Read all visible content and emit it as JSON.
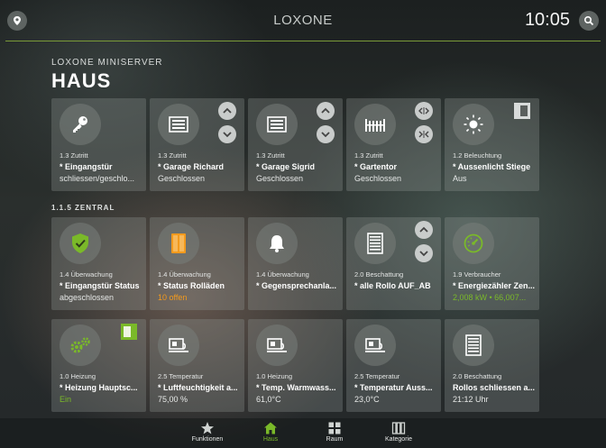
{
  "header": {
    "app_title": "LOXONE",
    "clock": "10:05",
    "accent_color": "#7ab929"
  },
  "server_label": "LOXONE MINISERVER",
  "page_title": "HAUS",
  "section_label": "1.1.5 ZENTRAL",
  "tiles": [
    {
      "category": "1.3 Zutritt",
      "name": "* Eingangstür",
      "status": "schliessen/geschlo...",
      "icon": "key-icon"
    },
    {
      "category": "1.3 Zutritt",
      "name": "* Garage Richard",
      "status": "Geschlossen",
      "icon": "garage-door-icon"
    },
    {
      "category": "1.3 Zutritt",
      "name": "* Garage Sigrid",
      "status": "Geschlossen",
      "icon": "garage-door-icon"
    },
    {
      "category": "1.3 Zutritt",
      "name": "* Gartentor",
      "status": "Geschlossen",
      "icon": "gate-icon"
    },
    {
      "category": "1.2 Beleuchtung",
      "name": "* Aussenlicht Stiege",
      "status": "Aus",
      "icon": "sun-icon"
    },
    {
      "category": "1.4 Überwachung",
      "name": "* Eingangstür Status",
      "status": "abgeschlossen",
      "icon": "shield-icon"
    },
    {
      "category": "1.4 Überwachung",
      "name": "* Status Rolläden",
      "status": "10 offen",
      "icon": "window-icon"
    },
    {
      "category": "1.4 Überwachung",
      "name": "* Gegensprechanla...",
      "status": "",
      "icon": "bell-icon"
    },
    {
      "category": "2.0 Beschattung",
      "name": "* alle Rollo AUF_AB",
      "status": "",
      "icon": "blind-icon"
    },
    {
      "category": "1.9 Verbraucher",
      "name": "* Energiezähler Zen...",
      "status": "2,008 kW • 66,007...",
      "icon": "gauge-icon"
    },
    {
      "category": "1.0 Heizung",
      "name": "* Heizung Hauptsc...",
      "status": "Ein",
      "icon": "gears-icon"
    },
    {
      "category": "2.5 Temperatur",
      "name": "* Luftfeuchtigkeit a...",
      "status": "75,00 %",
      "icon": "sensor-icon"
    },
    {
      "category": "1.0 Heizung",
      "name": "* Temp. Warmwass...",
      "status": "61,0°C",
      "icon": "sensor-icon"
    },
    {
      "category": "2.5 Temperatur",
      "name": "* Temperatur Auss...",
      "status": "23,0°C",
      "icon": "sensor-icon"
    },
    {
      "category": "2.0 Beschattung",
      "name": "Rollos schliessen a...",
      "status": "21:12 Uhr",
      "icon": "blind-icon"
    }
  ],
  "nav": [
    {
      "label": "Funktionen",
      "icon": "star-icon"
    },
    {
      "label": "Haus",
      "icon": "house-icon"
    },
    {
      "label": "Raum",
      "icon": "grid-icon"
    },
    {
      "label": "Kategorie",
      "icon": "columns-icon"
    }
  ]
}
